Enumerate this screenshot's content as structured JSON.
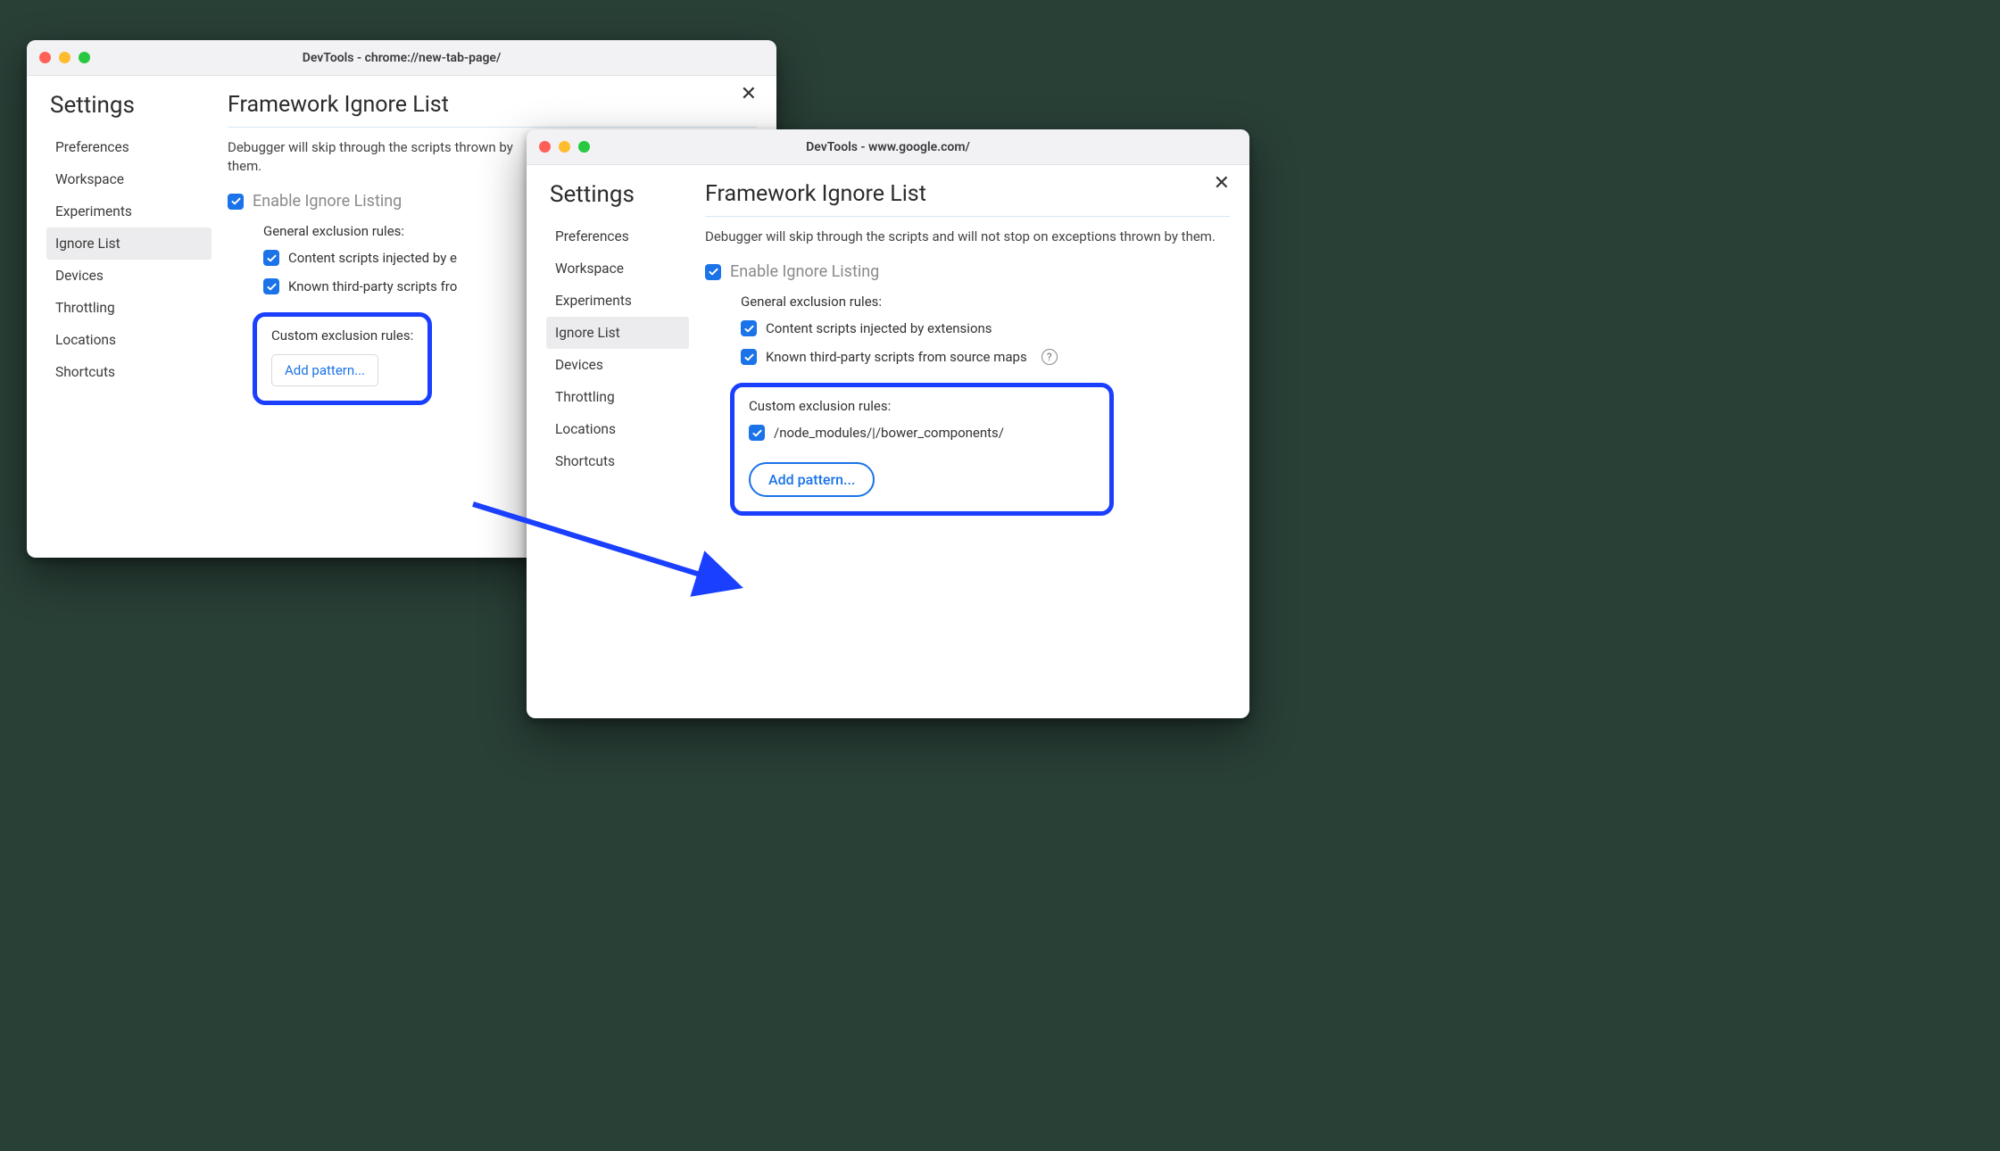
{
  "accent": "#1a73e8",
  "highlight": "#1a3fff",
  "window_back": {
    "title": "DevTools - chrome://new-tab-page/",
    "settings_label": "Settings",
    "sidebar": {
      "items": [
        {
          "label": "Preferences"
        },
        {
          "label": "Workspace"
        },
        {
          "label": "Experiments"
        },
        {
          "label": "Ignore List",
          "active": true
        },
        {
          "label": "Devices"
        },
        {
          "label": "Throttling"
        },
        {
          "label": "Locations"
        },
        {
          "label": "Shortcuts"
        }
      ]
    },
    "main": {
      "title": "Framework Ignore List",
      "description": "Debugger will skip through the scripts and will not stop on exceptions thrown by them.",
      "description_visible": "Debugger will skip through the scripts thrown by them.",
      "enable_label": "Enable Ignore Listing",
      "enable_checked": true,
      "general_rules_title": "General exclusion rules:",
      "rules": [
        {
          "label_visible": "Content scripts injected by e",
          "checked": true
        },
        {
          "label_visible": "Known third-party scripts fro",
          "checked": true
        }
      ],
      "custom_title": "Custom exclusion rules:",
      "add_pattern": "Add pattern..."
    }
  },
  "window_front": {
    "title": "DevTools - www.google.com/",
    "settings_label": "Settings",
    "sidebar": {
      "items": [
        {
          "label": "Preferences"
        },
        {
          "label": "Workspace"
        },
        {
          "label": "Experiments"
        },
        {
          "label": "Ignore List",
          "active": true
        },
        {
          "label": "Devices"
        },
        {
          "label": "Throttling"
        },
        {
          "label": "Locations"
        },
        {
          "label": "Shortcuts"
        }
      ]
    },
    "main": {
      "title": "Framework Ignore List",
      "description": "Debugger will skip through the scripts and will not stop on exceptions thrown by them.",
      "enable_label": "Enable Ignore Listing",
      "enable_checked": true,
      "general_rules_title": "General exclusion rules:",
      "rules": [
        {
          "label": "Content scripts injected by extensions",
          "checked": true
        },
        {
          "label": "Known third-party scripts from source maps",
          "checked": true,
          "help": true
        }
      ],
      "custom_title": "Custom exclusion rules:",
      "custom_patterns": [
        {
          "pattern": "/node_modules/|/bower_components/",
          "checked": true
        }
      ],
      "add_pattern": "Add pattern..."
    }
  }
}
